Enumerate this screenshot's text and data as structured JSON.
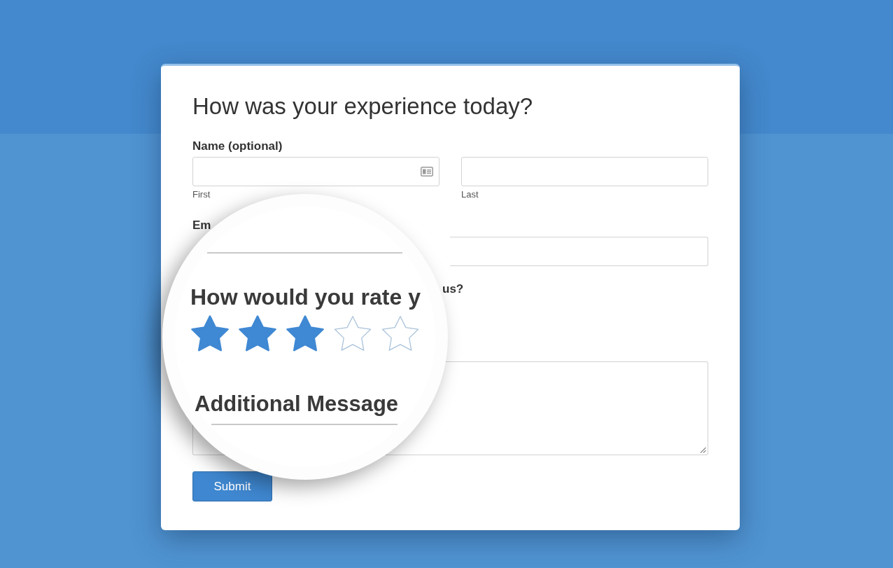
{
  "form": {
    "title": "How was your experience today?",
    "name_field": {
      "label": "Name (optional)",
      "parts": [
        {
          "sublabel": "First",
          "kind": "icon"
        },
        {
          "sublabel": "Last",
          "kind": "plain"
        }
      ]
    },
    "email_field": {
      "label": "Em"
    },
    "rating_field": {
      "label": "us?"
    },
    "submit_button": "Submit"
  },
  "magnifier": {
    "rating_label": "How would you rate y",
    "rating": {
      "stars": 3
    },
    "message_label": "Additional Message"
  }
}
